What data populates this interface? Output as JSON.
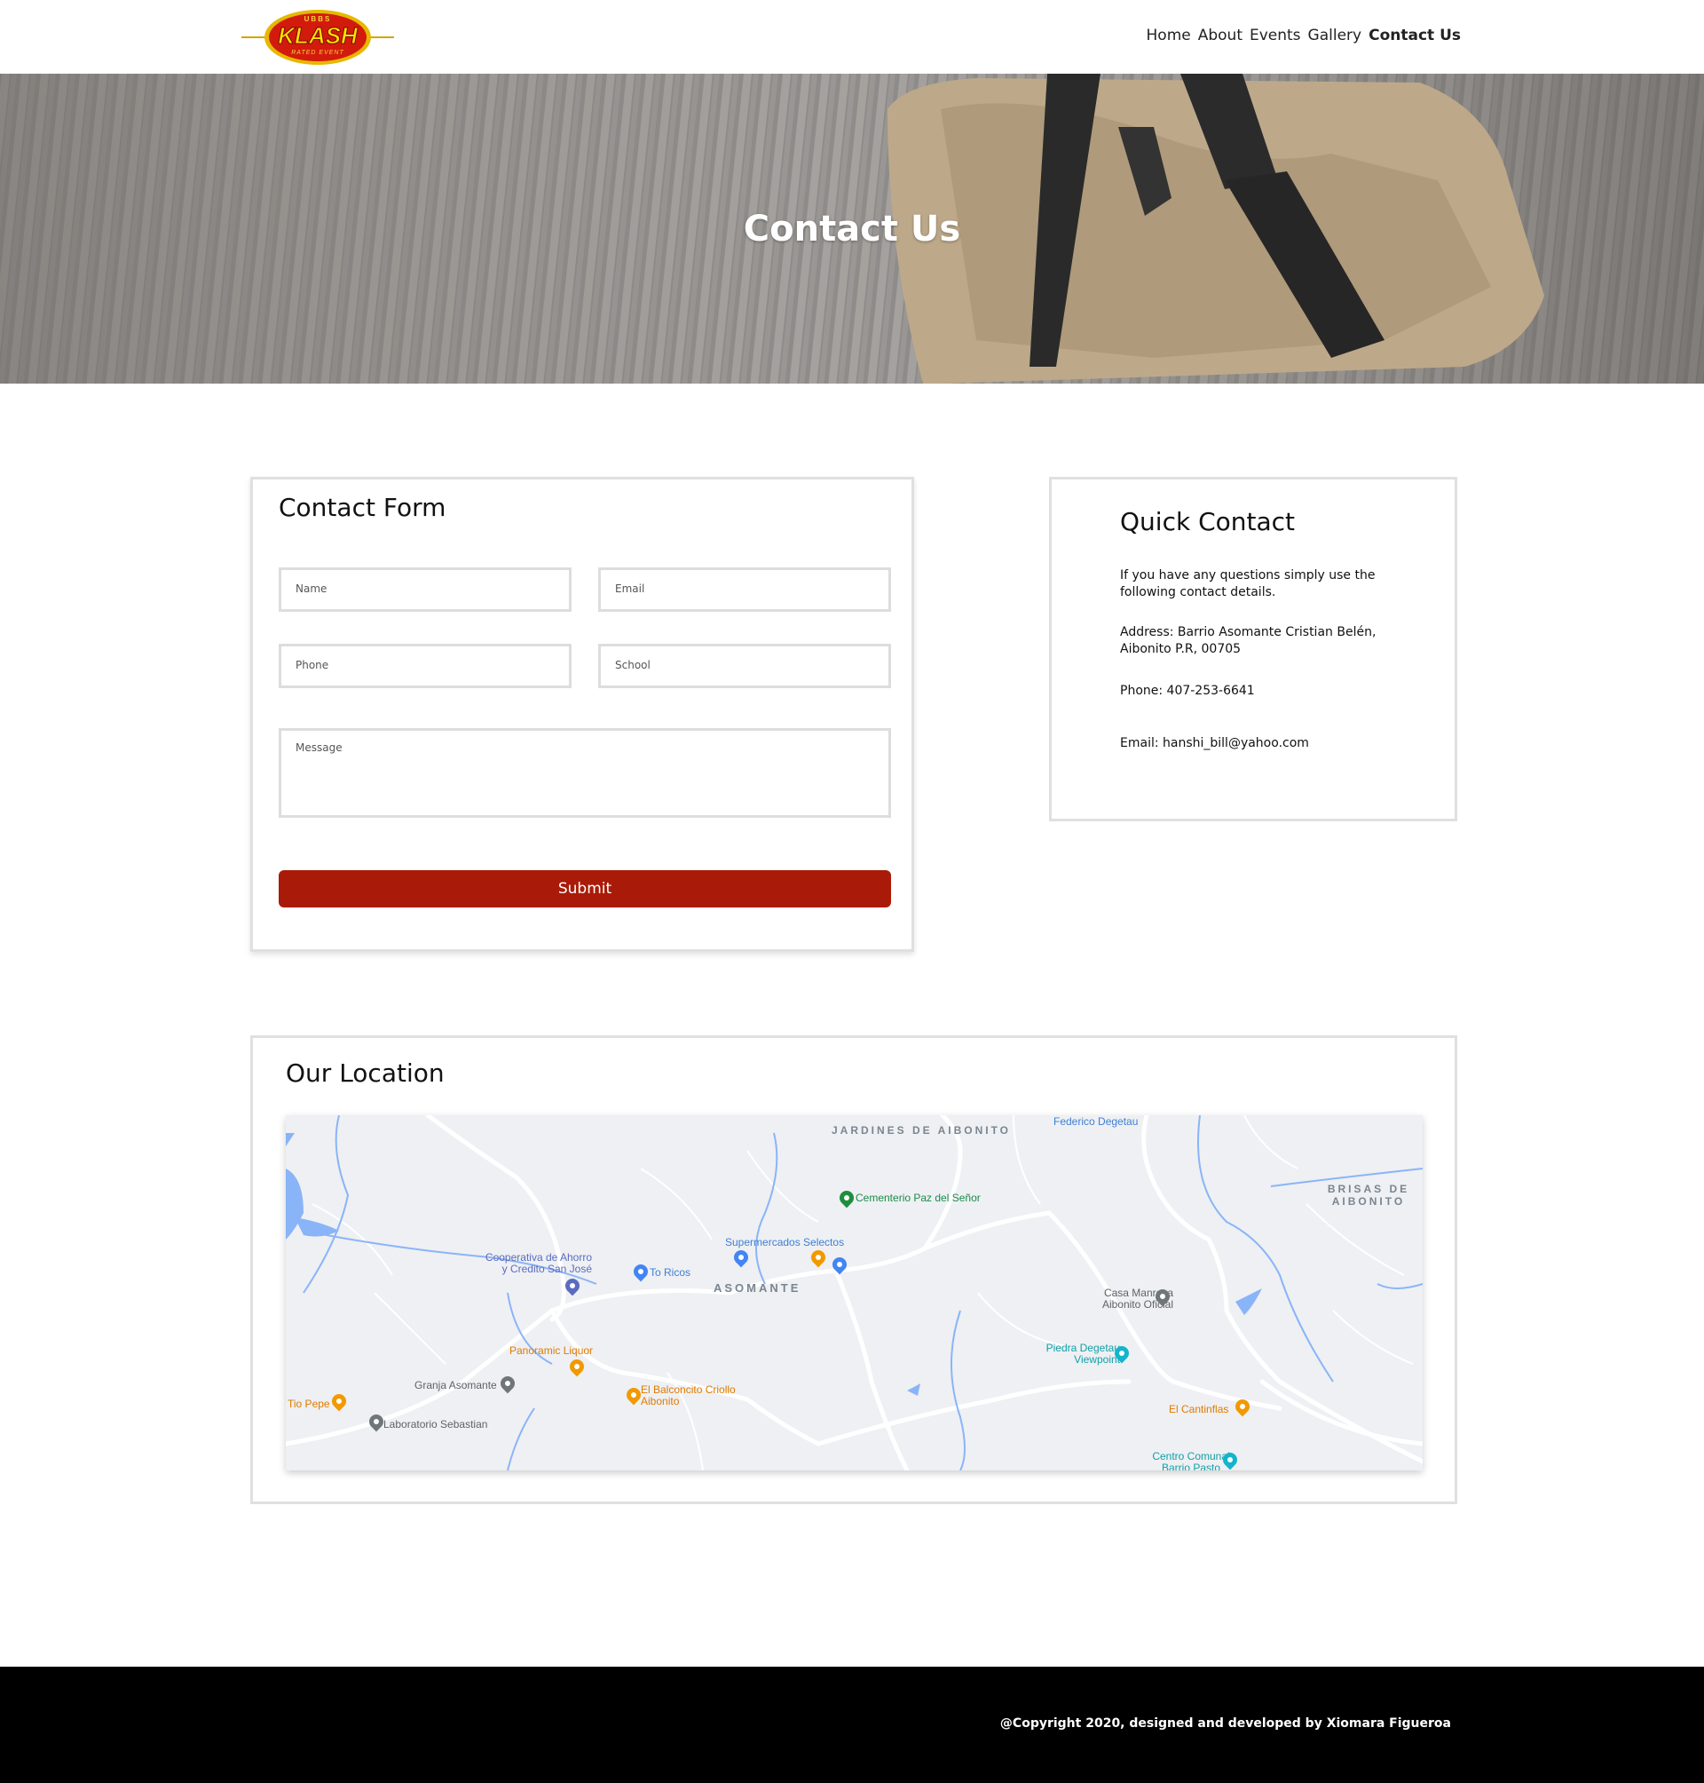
{
  "header": {
    "logo": {
      "top_text": "UBBS",
      "main_text": "KLASH",
      "bottom_text": "RATED EVENT"
    },
    "nav": [
      "Home",
      "About",
      "Events",
      "Gallery",
      "Contact Us"
    ],
    "active_nav": "Contact Us"
  },
  "hero": {
    "title": "Contact Us"
  },
  "contact_form": {
    "title": "Contact Form",
    "fields": {
      "name": "Name",
      "email": "Email",
      "phone": "Phone",
      "school": "School",
      "message": "Message"
    },
    "submit_label": "Submit",
    "submit_color": "#a91b08"
  },
  "quick_contact": {
    "title": "Quick Contact",
    "intro": "If you have any questions simply use the following contact details.",
    "address": "Address: Barrio Asomante Cristian Belén, Aibonito P.R, 00705",
    "phone": "Phone: 407-253-6641",
    "email": "Email: hanshi_bill@yahoo.com"
  },
  "location": {
    "title": "Our Location",
    "map_labels": {
      "jardines": "JARDINES DE AIBONITO",
      "brisas": "BRISAS DE AIBONITO",
      "asomante": "ASOMANTE",
      "federico": "Federico Degetau",
      "cementerio": "Cementerio Paz del Señor",
      "supermercados": "Supermercados Selectos",
      "cooperativa": "Cooperativa de Ahorro y Credito San José",
      "toricos": "To Ricos",
      "casa_manresa": "Casa Manresa Aibonito Oficial",
      "panoramic": "Panoramic Liquor",
      "piedra": "Piedra Degetau Viewpoint",
      "granja": "Granja Asomante",
      "balconcito": "El Balconcito Criollo Aibonito",
      "tio_pepe": "Tio Pepe",
      "laboratorio": "Laboratorio Sebastian",
      "cantinflas": "El Cantinflas",
      "centro": "Centro Comunal Barrio Pasto"
    }
  },
  "footer": {
    "copyright": "@Copyright 2020, designed and developed by Xiomara Figueroa"
  }
}
